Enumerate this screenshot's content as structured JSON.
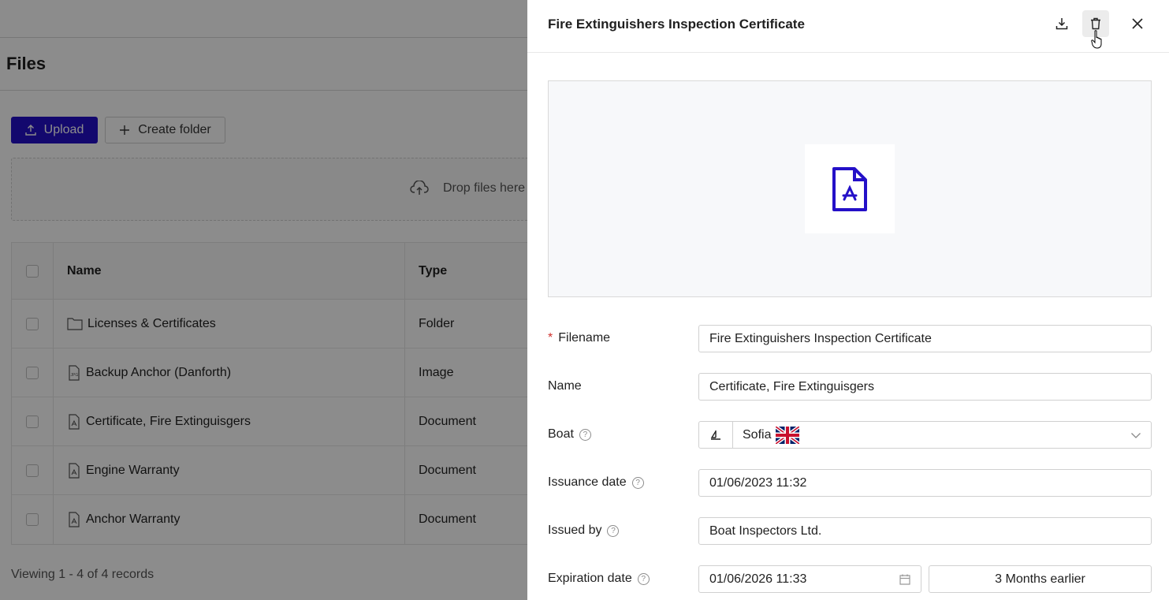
{
  "page": {
    "title": "Files",
    "upload_label": "Upload",
    "create_folder_label": "Create folder",
    "dropzone_text": "Drop files here",
    "table": {
      "headers": {
        "name": "Name",
        "type": "Type"
      },
      "rows": [
        {
          "name": "Licenses & Certificates",
          "type": "Folder",
          "icon": "folder-icon"
        },
        {
          "name": "Backup Anchor (Danforth)",
          "type": "Image",
          "icon": "image-file-icon"
        },
        {
          "name": "Certificate, Fire Extinguisgers",
          "type": "Document",
          "icon": "pdf-file-icon"
        },
        {
          "name": "Engine Warranty",
          "type": "Document",
          "icon": "pdf-file-icon"
        },
        {
          "name": "Anchor Warranty",
          "type": "Document",
          "icon": "pdf-file-icon"
        }
      ]
    },
    "footer": "Viewing 1 - 4 of 4 records"
  },
  "drawer": {
    "title": "Fire Extinguishers Inspection Certificate",
    "form": {
      "filename_label": "Filename",
      "filename_value": "Fire Extinguishers Inspection Certificate",
      "name_label": "Name",
      "name_value": "Certificate, Fire Extinguisgers",
      "boat_label": "Boat",
      "boat_value": "Sofia",
      "issuance_label": "Issuance date",
      "issuance_value": "01/06/2023 11:32",
      "issued_by_label": "Issued by",
      "issued_by_value": "Boat Inspectors Ltd.",
      "expiration_label": "Expiration date",
      "expiration_value": "01/06/2026 11:33",
      "reminder_label": "3 Months earlier"
    }
  },
  "colors": {
    "accent": "#2410c8",
    "required": "#d0312d"
  }
}
